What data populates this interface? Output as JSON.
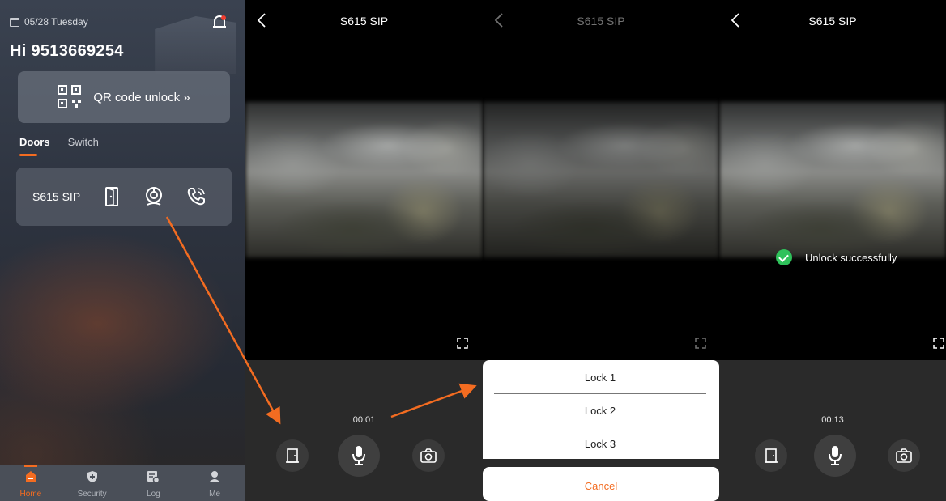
{
  "home": {
    "date": "05/28 Tuesday",
    "greeting": "Hi 9513669254",
    "qr_label": "QR code unlock »",
    "tabs": [
      "Doors",
      "Switch"
    ],
    "door_name": "S615 SIP",
    "nav": [
      "Home",
      "Security",
      "Log",
      "Me"
    ],
    "icons": {
      "calendar": "calendar-icon",
      "bell": "bell-icon",
      "qr": "qr-code-icon",
      "door": "door-icon",
      "monitor": "camera-monitor-icon",
      "call": "phone-call-icon"
    }
  },
  "call_panel_1": {
    "title": "S615 SIP",
    "timer": "00:01"
  },
  "call_panel_2": {
    "title": "S615 SIP",
    "locks": [
      "Lock 1",
      "Lock 2",
      "Lock 3"
    ],
    "cancel": "Cancel"
  },
  "call_panel_3": {
    "title": "S615 SIP",
    "timer": "00:13",
    "toast": "Unlock successfully"
  },
  "colors": {
    "accent": "#f36c21",
    "success": "#2fc25b",
    "panel_bg": "#2a2a2a"
  }
}
